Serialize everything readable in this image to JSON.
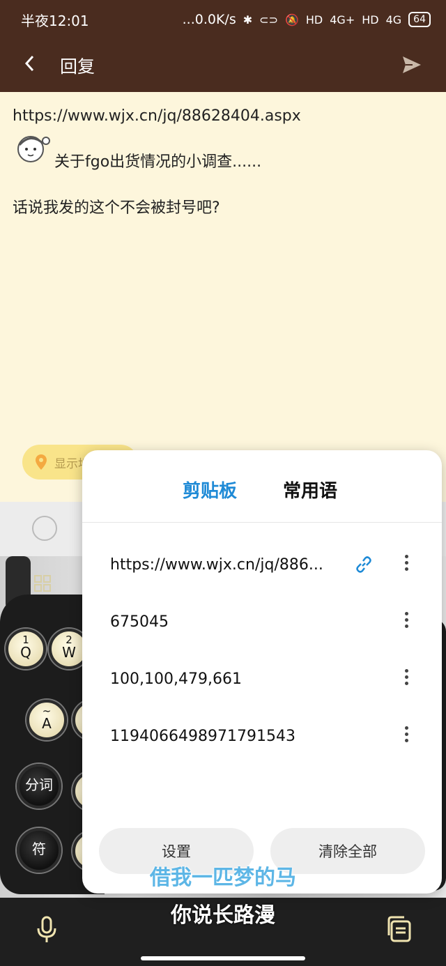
{
  "status": {
    "time": "半夜12:01",
    "net_speed": "...0.0K/s",
    "signal1": "4G+",
    "signal2": "4G",
    "hd": "HD",
    "battery": "64"
  },
  "appbar": {
    "title": "回复"
  },
  "compose": {
    "line1": "https://www.wjx.cn/jq/88628404.aspx",
    "line2": "关于fgo出货情况的小调查......",
    "line3": "话说我发的这个不会被封号吧?",
    "location_chip": "显示地"
  },
  "keyboard": {
    "keys": [
      {
        "num": "1",
        "ltr": "Q"
      },
      {
        "num": "2",
        "ltr": "W"
      },
      {
        "num": "~",
        "ltr": "A"
      }
    ],
    "seg_label": "分词",
    "sym_label": "符"
  },
  "clipboard_panel": {
    "tabs": [
      "剪贴板",
      "常用语"
    ],
    "items": [
      "https://www.wjx.cn/jq/886...",
      "675045",
      "100,100,479,661",
      "1194066498971791543"
    ],
    "settings_label": "设置",
    "clear_label": "清除全部"
  },
  "subtitles": {
    "line1": "借我一匹梦的马",
    "line2": "你说长路漫"
  },
  "colors": {
    "header": "#4a2c1f",
    "compose_bg": "#fdf6dc",
    "accent": "#1e8ad6"
  }
}
